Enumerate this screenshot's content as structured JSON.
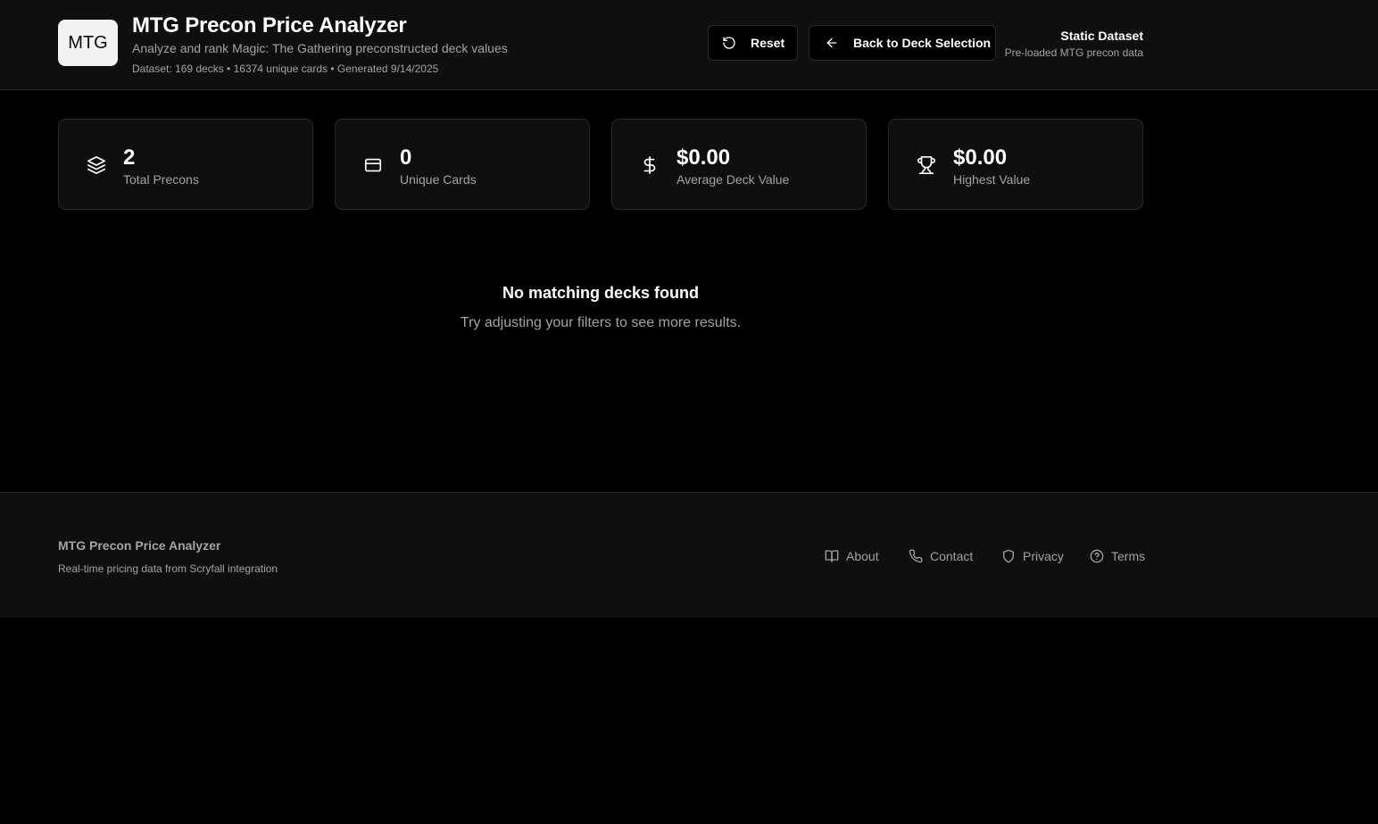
{
  "header": {
    "logo_text": "MTG",
    "title": "MTG Precon Price Analyzer",
    "subtitle": "Analyze and rank Magic: The Gathering preconstructed deck values",
    "dataset_info": "Dataset: 169 decks • 16374 unique cards • Generated 9/14/2025",
    "reset_label": "Reset",
    "back_label": "Back to Deck Selection",
    "dataset_title": "Static Dataset",
    "dataset_subtitle": "Pre-loaded MTG precon data"
  },
  "stats": [
    {
      "icon": "layers-icon",
      "value": "2",
      "label": "Total Precons"
    },
    {
      "icon": "card-icon",
      "value": "0",
      "label": "Unique Cards"
    },
    {
      "icon": "dollar-icon",
      "value": "$0.00",
      "label": "Average Deck Value"
    },
    {
      "icon": "trophy-icon",
      "value": "$0.00",
      "label": "Highest Value"
    }
  ],
  "empty_state": {
    "title": "No matching decks found",
    "message": "Try adjusting your filters to see more results."
  },
  "footer": {
    "title": "MTG Precon Price Analyzer",
    "subtitle": "Real-time pricing data from Scryfall integration",
    "links": [
      {
        "icon": "book-icon",
        "label": "About"
      },
      {
        "icon": "phone-icon",
        "label": "Contact"
      },
      {
        "icon": "shield-icon",
        "label": "Privacy"
      },
      {
        "icon": "help-circle-icon",
        "label": "Terms"
      }
    ]
  },
  "colors": {
    "background": "#000000",
    "surface": "#0f0f0f",
    "border": "#262626",
    "muted_text": "#a3a3a3",
    "logo_bg": "#f2f2f2"
  }
}
